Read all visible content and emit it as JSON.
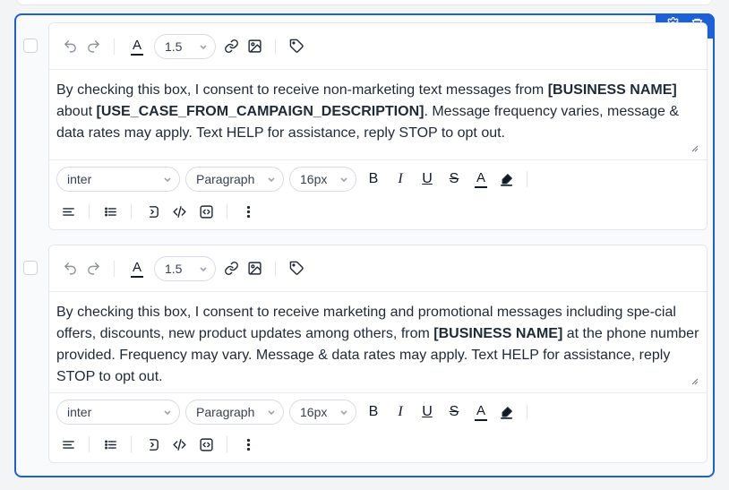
{
  "corner_actions": {
    "settings_icon": "gear-icon",
    "delete_icon": "trash-icon"
  },
  "editors": [
    {
      "line_height": "1.5",
      "segments": [
        {
          "text": "By checking this box, I consent to receive non-marketing text messages from ",
          "bold": false
        },
        {
          "text": "[BUSINESS NAME]",
          "bold": true
        },
        {
          "text": " about ",
          "bold": false
        },
        {
          "text": "[USE_CASE_FROM_CAMPAIGN_DESCRIPTION]",
          "bold": true
        },
        {
          "text": ". Message frequency varies, message & data rates may apply. Text HELP for assistance, reply STOP to opt out.",
          "bold": false
        }
      ],
      "font_family": "inter",
      "block_type": "Paragraph",
      "font_size": "16px"
    },
    {
      "line_height": "1.5",
      "segments": [
        {
          "text": "By checking this box, I consent to receive marketing and promotional messages including spe-cial offers, discounts, new product updates among others, from ",
          "bold": false
        },
        {
          "text": "[BUSINESS NAME]",
          "bold": true
        },
        {
          "text": " at the phone number provided. Frequency may vary. Message & data rates may apply. Text HELP for assistance, reply STOP to opt out.",
          "bold": false
        }
      ],
      "font_family": "inter",
      "block_type": "Paragraph",
      "font_size": "16px"
    }
  ],
  "format_labels": {
    "bold": "B",
    "italic": "I",
    "underline": "U",
    "strike": "S",
    "color": "A"
  }
}
